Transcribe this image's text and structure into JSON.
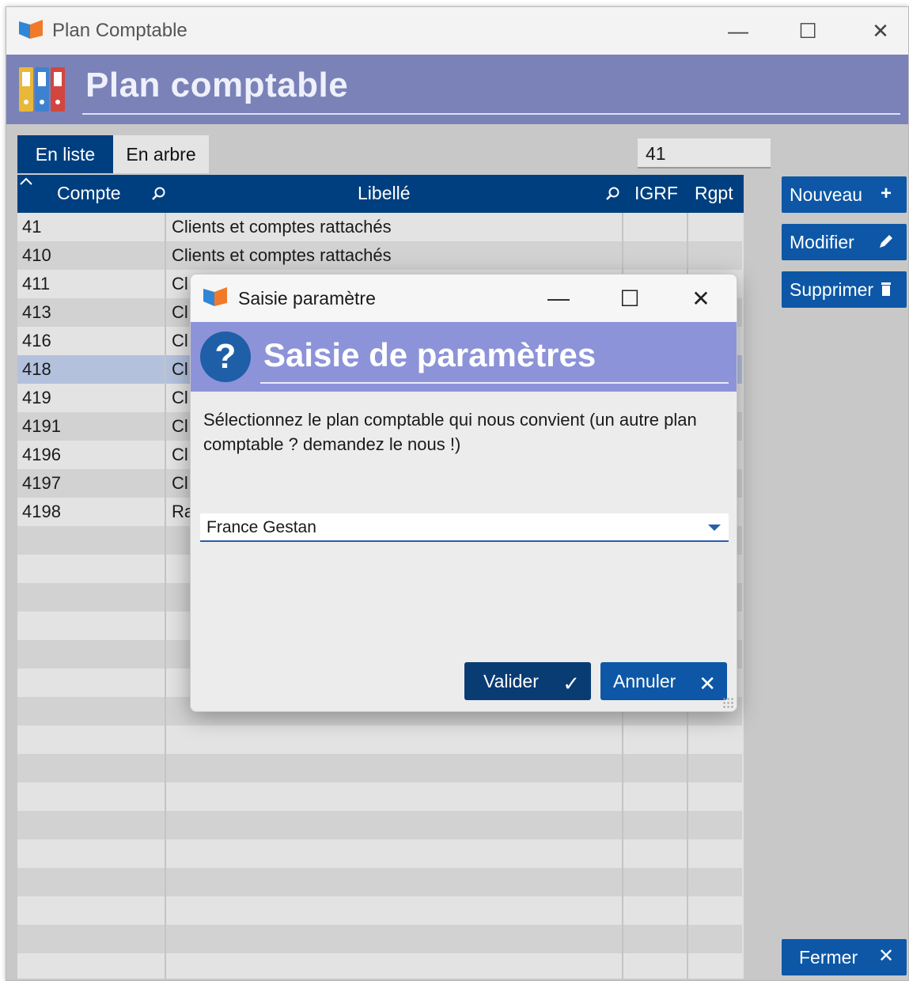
{
  "window": {
    "title": "Plan Comptable",
    "banner_title": "Plan comptable",
    "controls": {
      "minimize": "—",
      "maximize": "☐",
      "close": "✕"
    }
  },
  "tabs": [
    {
      "label": "En liste",
      "active": true
    },
    {
      "label": "En arbre",
      "active": false
    }
  ],
  "search": {
    "value": "41"
  },
  "grid": {
    "columns": [
      "Compte",
      "Libellé",
      "IGRF",
      "Rgpt"
    ],
    "rows": [
      {
        "compte": "41",
        "libelle": "Clients et comptes rattachés"
      },
      {
        "compte": "410",
        "libelle": "Clients et comptes rattachés"
      },
      {
        "compte": "411",
        "libelle": "Cl"
      },
      {
        "compte": "413",
        "libelle": "Cl"
      },
      {
        "compte": "416",
        "libelle": "Cl"
      },
      {
        "compte": "418",
        "libelle": "Cl",
        "selected": true
      },
      {
        "compte": "419",
        "libelle": "Cl"
      },
      {
        "compte": "4191",
        "libelle": "Cl"
      },
      {
        "compte": "4196",
        "libelle": "Cl"
      },
      {
        "compte": "4197",
        "libelle": "Cl"
      },
      {
        "compte": "4198",
        "libelle": "Ra"
      }
    ]
  },
  "side_buttons": {
    "nouveau": "Nouveau",
    "modifier": "Modifier",
    "supprimer": "Supprimer",
    "fermer": "Fermer"
  },
  "dialog": {
    "title": "Saisie paramètre",
    "banner_title": "Saisie de paramètres",
    "message": "Sélectionnez le plan comptable qui nous convient (un autre plan comptable ? demandez le nous !)",
    "select_value": "France Gestan",
    "valider": "Valider",
    "annuler": "Annuler"
  },
  "colors": {
    "accent_dark": "#003f7f",
    "accent_button": "#0d57a6",
    "banner": "#7b82b8",
    "dialog_banner": "#8d93d8",
    "selected_row": "#b3c1dd"
  }
}
